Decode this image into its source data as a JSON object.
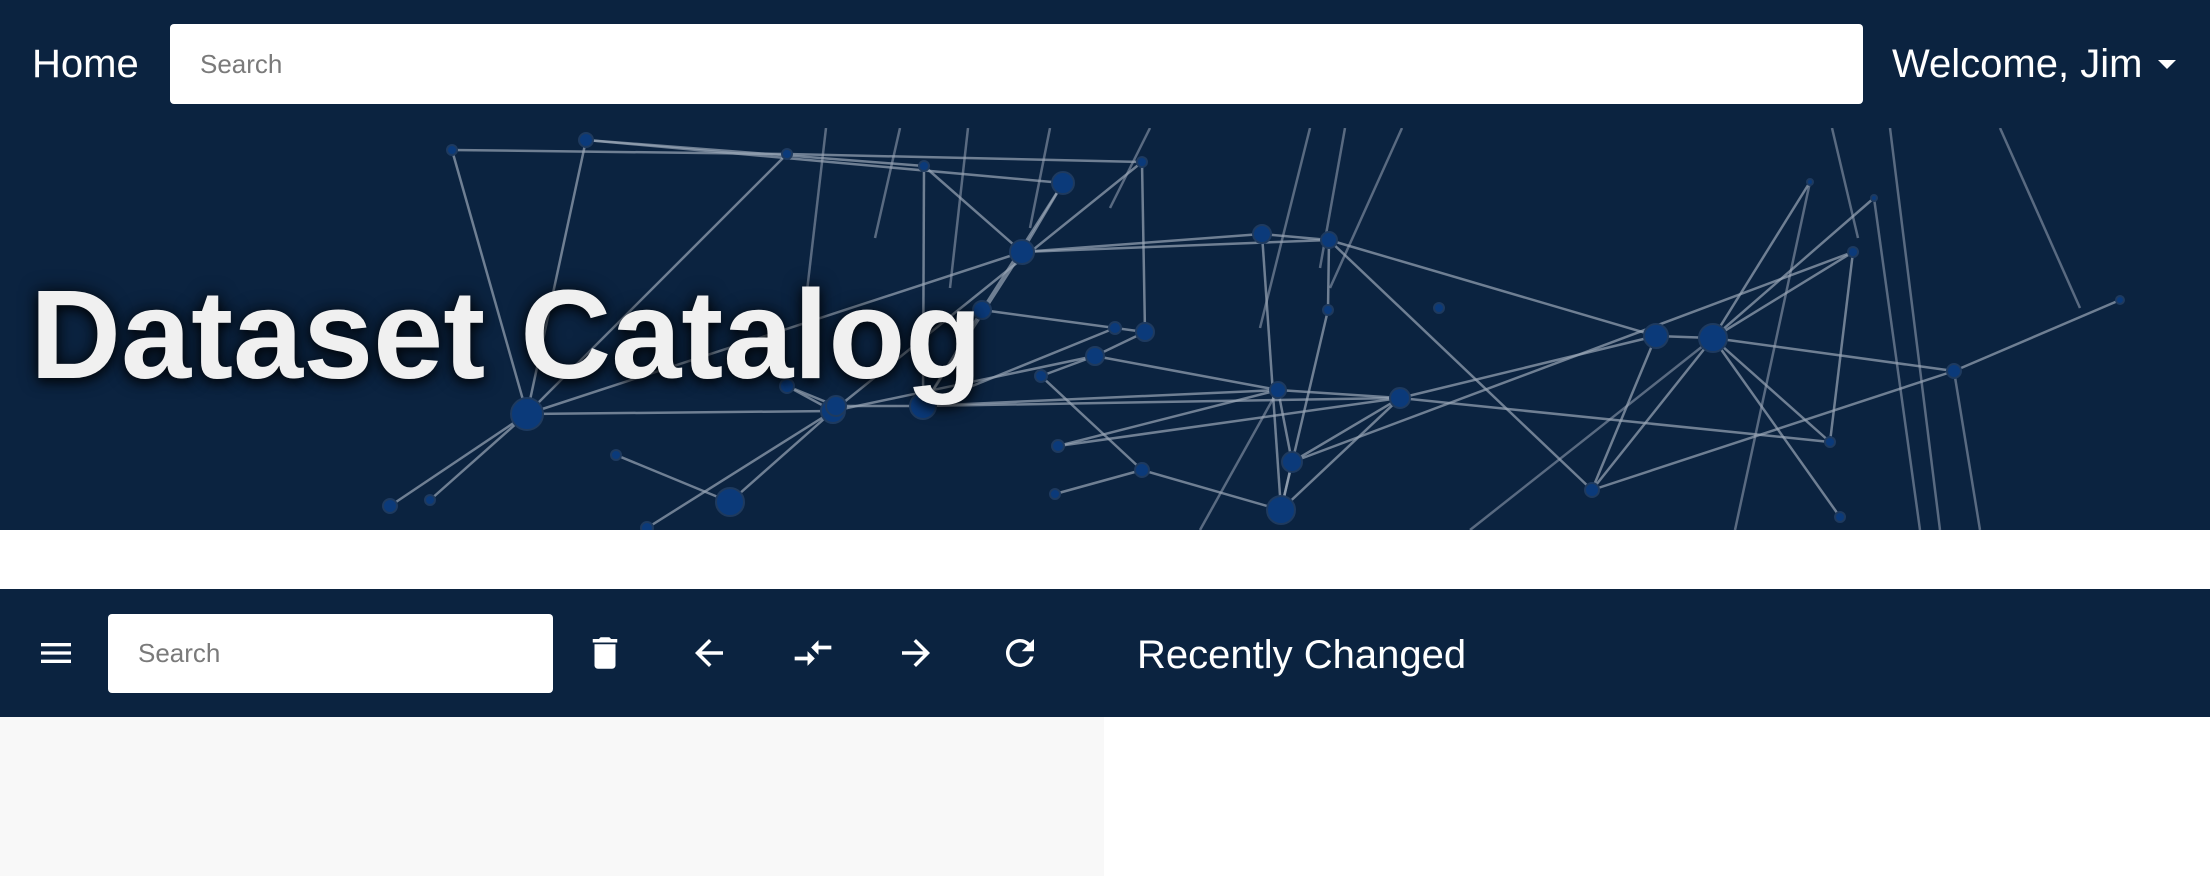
{
  "navbar": {
    "home_label": "Home",
    "search_placeholder": "Search",
    "user_label": "Welcome, Jim"
  },
  "hero": {
    "title": "Dataset Catalog"
  },
  "toolbar": {
    "search_placeholder": "Search",
    "icons": [
      "menu-icon",
      "trash-icon",
      "arrow-left-icon",
      "compare-arrows-icon",
      "arrow-right-icon",
      "refresh-icon"
    ],
    "panel_title": "Recently Changed"
  },
  "colors": {
    "primary": "#0b2340",
    "node": "#0b3a7a",
    "edge": "#9aa6b6",
    "left_pane": "#f8f8f8"
  }
}
